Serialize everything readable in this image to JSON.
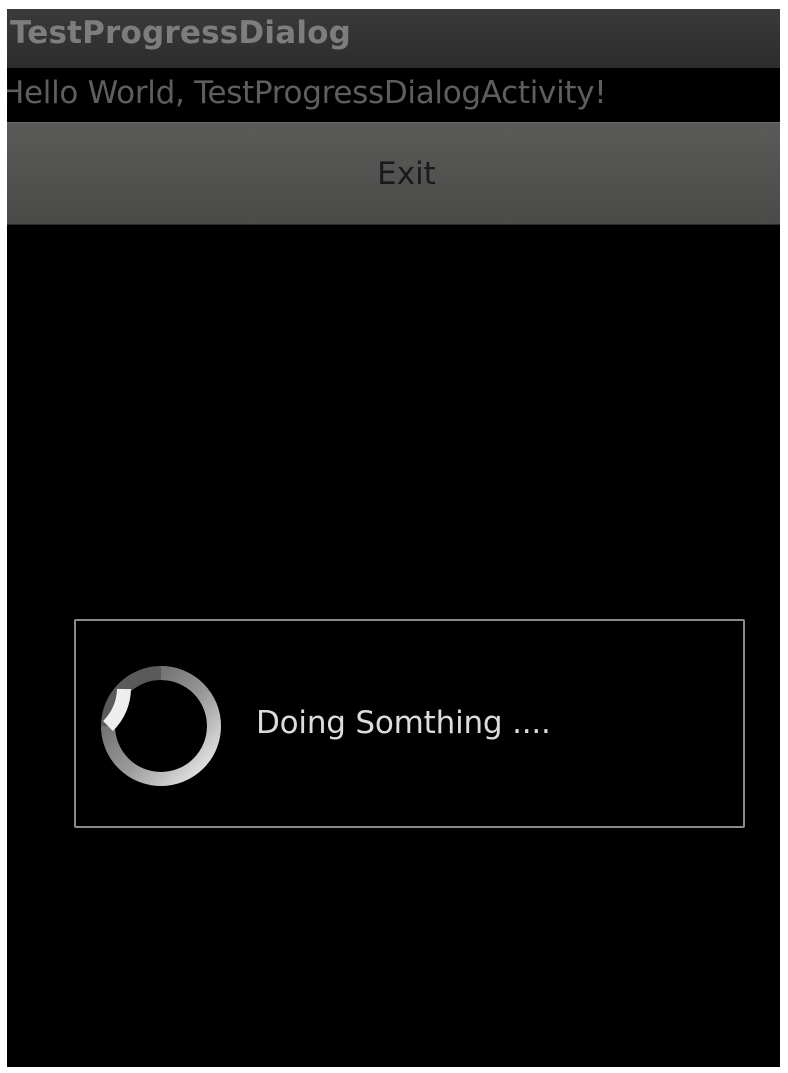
{
  "app": {
    "title": "TestProgressDialog"
  },
  "main": {
    "hello_text": "Hello World, TestProgressDialogActivity!",
    "exit_label": "Exit"
  },
  "progress_dialog": {
    "message": "Doing Somthing ....",
    "spinner_icon": "indeterminate-spinner-icon"
  },
  "colors": {
    "background": "#000000",
    "title_bar": "#333333",
    "title_text": "#7d7d7d",
    "button": "#525351",
    "dialog_border": "#8a8a8a",
    "dialog_text": "#dcdcdc"
  }
}
